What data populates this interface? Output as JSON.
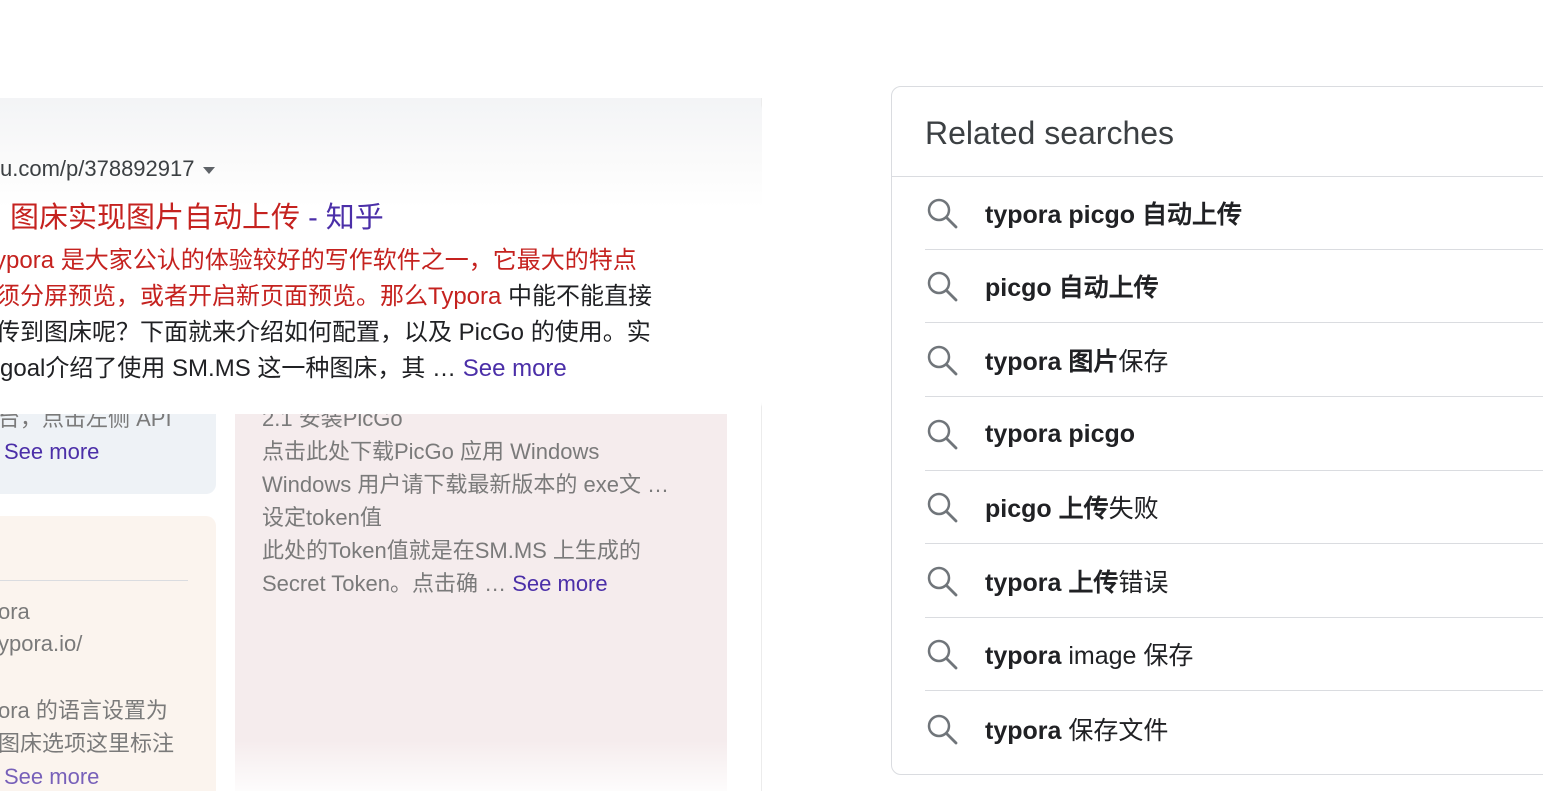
{
  "result": {
    "url": "u.com/p/378892917",
    "title_part1": "图床实现图片自动上传",
    "title_part2": " - 知乎",
    "desc_lines": [
      {
        "hl": "ypora 是大家公认的体验较好的写作软件之一，它最大的特点",
        "rest": ""
      },
      {
        "hl": "须分屏预览，或者开启新页面预览。那么Typora",
        "rest": " 中能不能直接"
      },
      {
        "hl": "",
        "rest": "传到图床呢？下面就来介绍如何配置，以及 PicGo 的使用。实"
      },
      {
        "hl": "",
        "rest": "goal介绍了使用 SM.MS 这一种图床，其 … "
      }
    ],
    "desc_see_more": "See more"
  },
  "left_snippets": {
    "top_partial": "台，点击左侧 API",
    "top_see_more": "See more",
    "bottom_lines": [
      "ora",
      "ypora.io/",
      "ora 的语言设置为",
      "图床选项这里标注"
    ],
    "bottom_see_more": "See more"
  },
  "mid_snippet": {
    "partial": "2.1 安装PicGo",
    "lines": [
      "点击此处下载PicGo 应用 Windows",
      "Windows 用户请下载最新版本的 exe文 …",
      "设定token值",
      "此处的Token值就是在SM.MS 上生成的",
      "Secret Token。点击确 … "
    ],
    "see_more": "See more"
  },
  "related": {
    "title": "Related searches",
    "items": [
      {
        "bold": "typora picgo 自动上传",
        "normal": ""
      },
      {
        "bold": "picgo 自动上传",
        "normal": ""
      },
      {
        "bold": "typora 图片",
        "normal": "保存"
      },
      {
        "bold": "typora picgo",
        "normal": ""
      },
      {
        "bold": "picgo 上传",
        "normal": "失败"
      },
      {
        "bold": "typora 上传",
        "normal": "错误"
      },
      {
        "bold": "typora",
        "normal": " image 保存"
      },
      {
        "bold": "typora",
        "normal": " 保存文件"
      }
    ],
    "icon": "search-icon"
  }
}
